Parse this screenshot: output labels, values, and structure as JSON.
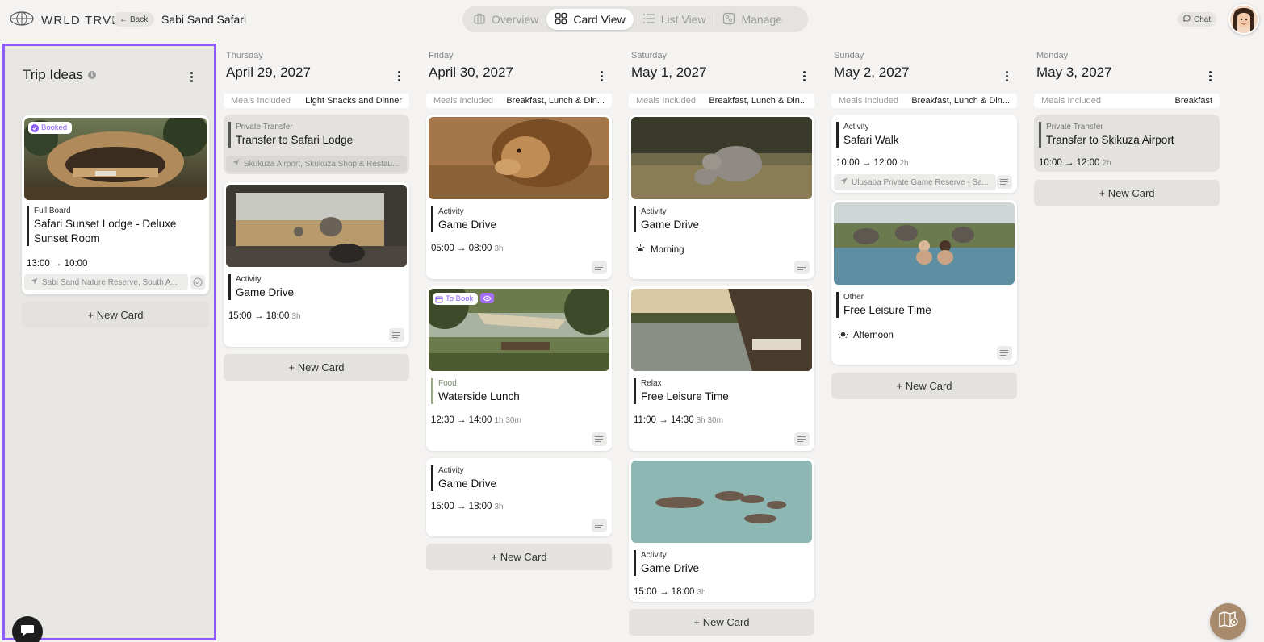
{
  "app": {
    "brand": "WRLD TRVL",
    "back_label": "Back",
    "trip_title": "Sabi Sand Safari",
    "chat_label": "Chat"
  },
  "view_tabs": [
    {
      "label": "Overview",
      "icon": "suitcase-icon",
      "active": false
    },
    {
      "label": "Card View",
      "icon": "grid-icon",
      "active": true
    },
    {
      "label": "List View",
      "icon": "list-icon",
      "active": false
    },
    {
      "label": "Manage",
      "icon": "manage-icon",
      "active": false
    }
  ],
  "ideas": {
    "title": "Trip Ideas",
    "card": {
      "badge": "Booked",
      "category": "Full Board",
      "title": "Safari Sunset Lodge - Deluxe Sunset Room",
      "time": "13:00 → 10:00",
      "location": "Sabi Sand Nature Reserve, South A..."
    },
    "new_card": "+ New Card"
  },
  "meals_label": "Meals Included",
  "new_card_label": "+ New Card",
  "days": [
    {
      "weekday": "Thursday",
      "date": "April 29, 2027",
      "meals": "Light Snacks and Dinner",
      "cards": [
        {
          "category": "Private Transfer",
          "title": "Transfer to Safari Lodge",
          "location": "Skukuza Airport, Skukuza Shop & Restau..."
        },
        {
          "category": "Activity",
          "title": "Game Drive",
          "time": "15:00 → 18:00",
          "dur": "3h"
        }
      ]
    },
    {
      "weekday": "Friday",
      "date": "April 30, 2027",
      "meals": "Breakfast, Lunch & Din...",
      "cards": [
        {
          "category": "Activity",
          "title": "Game Drive",
          "time": "05:00 → 08:00",
          "dur": "3h"
        },
        {
          "badge": "To Book",
          "category": "Food",
          "title": "Waterside Lunch",
          "time": "12:30 → 14:00",
          "dur": "1h 30m"
        },
        {
          "category": "Activity",
          "title": "Game Drive",
          "time": "15:00 → 18:00",
          "dur": "3h"
        }
      ]
    },
    {
      "weekday": "Saturday",
      "date": "May 1, 2027",
      "meals": "Breakfast, Lunch & Din...",
      "cards": [
        {
          "category": "Activity",
          "title": "Game Drive",
          "time_of_day": "Morning"
        },
        {
          "category": "Relax",
          "title": "Free Leisure Time",
          "time": "11:00 → 14:30",
          "dur": "3h 30m"
        },
        {
          "category": "Activity",
          "title": "Game Drive",
          "time": "15:00 → 18:00",
          "dur": "3h"
        }
      ]
    },
    {
      "weekday": "Sunday",
      "date": "May 2, 2027",
      "meals": "Breakfast, Lunch & Din...",
      "cards": [
        {
          "category": "Activity",
          "title": "Safari Walk",
          "time": "10:00 → 12:00",
          "dur": "2h",
          "location": "Ulusaba Private Game Reserve - Sa..."
        },
        {
          "category": "Other",
          "title": "Free Leisure Time",
          "time_of_day": "Afternoon"
        }
      ]
    },
    {
      "weekday": "Monday",
      "date": "May 3, 2027",
      "meals": "Breakfast",
      "cards": [
        {
          "category": "Private Transfer",
          "title": "Transfer to Skikuza Airport",
          "time": "10:00 → 12:00",
          "dur": "2h"
        }
      ]
    }
  ]
}
